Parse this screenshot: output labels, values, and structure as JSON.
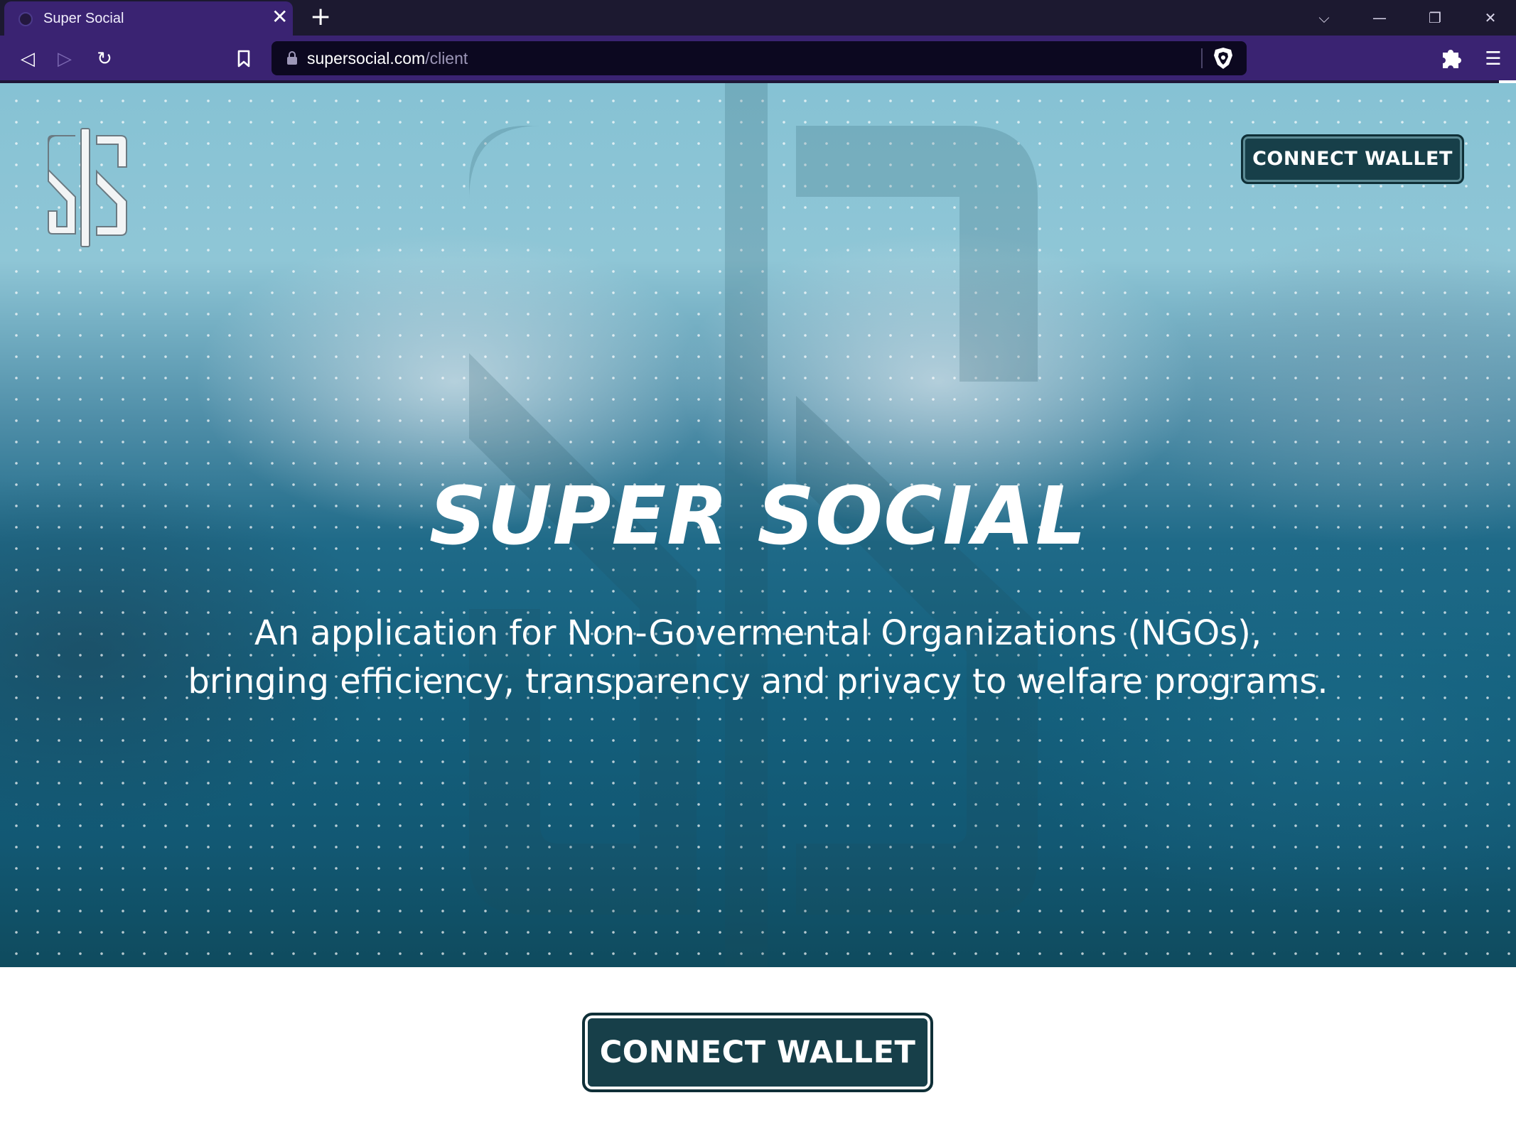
{
  "browser": {
    "tab_title": "Super Social",
    "tab_close": "✕",
    "new_tab": "+",
    "window_controls": {
      "tabs_dropdown": "⌵",
      "minimize": "—",
      "restore": "❐",
      "close": "✕"
    },
    "nav": {
      "back": "◁",
      "forward": "▷",
      "reload": "↻",
      "bookmark": "🔖",
      "menu": "☰"
    },
    "url_domain": "supersocial.com",
    "url_path": "/client"
  },
  "header": {
    "connect_wallet_label": "CONNECT WALLET"
  },
  "hero": {
    "title": "SUPER SOCIAL",
    "subtitle_line1": "An application for Non-Govermental Organizations (NGOs),",
    "subtitle_line2": "bringing efficiency, transparency and privacy to welfare programs."
  },
  "main": {
    "connect_wallet_label": "CONNECT WALLET"
  },
  "colors": {
    "browser_frame": "#1c1930",
    "browser_accent": "#3a2372",
    "button_bg": "#173f49",
    "hero_top": "#86c2d4",
    "hero_bottom": "#0f4b5e"
  }
}
